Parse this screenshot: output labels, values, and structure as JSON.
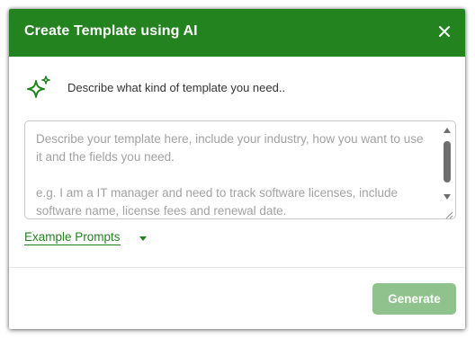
{
  "dialog": {
    "title": "Create Template using AI",
    "close_icon": "close-icon"
  },
  "prompt": {
    "icon": "sparkle-icon",
    "label": "Describe what kind of template you need.."
  },
  "description_input": {
    "value": "",
    "placeholder": "Describe your template here, include your industry, how you want to use it and the fields you need.\n\ne.g. I am a IT manager and need to track software licenses, include software name, license fees and renewal date."
  },
  "example_prompts": {
    "label": "Example Prompts",
    "icon": "caret-down-icon"
  },
  "footer": {
    "generate_label": "Generate"
  },
  "colors": {
    "header": "#23831f",
    "accent": "#23831f",
    "button_disabled": "#8fc28c"
  }
}
